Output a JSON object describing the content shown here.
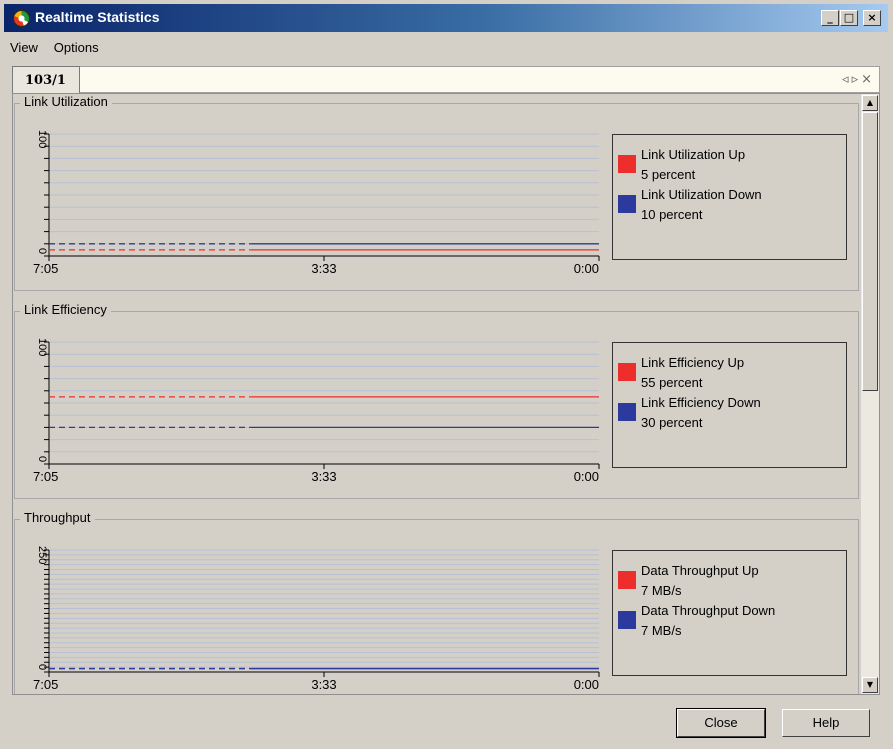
{
  "window": {
    "title": "Realtime Statistics",
    "minimize_glyph": "_",
    "maximize_glyph": "□",
    "close_glyph": "×"
  },
  "menu": [
    "View",
    "Options"
  ],
  "tab": {
    "label": "103/1",
    "controls": "◃▹×"
  },
  "panels": [
    {
      "title": "Link Utilization",
      "y_max_label": "100",
      "y_min_label": "0",
      "x_labels": [
        "7:05",
        "3:33",
        "0:00"
      ],
      "legend": [
        {
          "name": "Link Utilization Up",
          "value": "5 percent",
          "color": "#ee2d2d"
        },
        {
          "name": "Link Utilization Down",
          "value": "10 percent",
          "color": "#2b3a9c"
        }
      ]
    },
    {
      "title": "Link Efficiency",
      "y_max_label": "100",
      "y_min_label": "0",
      "x_labels": [
        "7:05",
        "3:33",
        "0:00"
      ],
      "legend": [
        {
          "name": "Link Efficiency Up",
          "value": "55 percent",
          "color": "#ee2d2d"
        },
        {
          "name": "Link Efficiency Down",
          "value": "30 percent",
          "color": "#2b3a9c"
        }
      ]
    },
    {
      "title": "Throughput",
      "y_max_label": "250",
      "y_min_label": "0",
      "x_labels": [
        "7:05",
        "3:33",
        "0:00"
      ],
      "legend": [
        {
          "name": "Data Throughput Up",
          "value": "7 MB/s",
          "color": "#ee2d2d"
        },
        {
          "name": "Data Throughput Down",
          "value": "7 MB/s",
          "color": "#2b3a9c"
        }
      ]
    }
  ],
  "buttons": {
    "close": "Close",
    "help": "Help"
  },
  "chart_data": [
    {
      "type": "line",
      "title": "Link Utilization",
      "ylim": [
        0,
        100
      ],
      "ytick_step": 10,
      "x": [
        "7:05",
        "3:33",
        "0:00"
      ],
      "series": [
        {
          "name": "Link Utilization Up",
          "values": [
            5,
            5,
            5
          ]
        },
        {
          "name": "Link Utilization Down",
          "values": [
            10,
            10,
            10
          ]
        }
      ]
    },
    {
      "type": "line",
      "title": "Link Efficiency",
      "ylim": [
        0,
        100
      ],
      "ytick_step": 10,
      "x": [
        "7:05",
        "3:33",
        "0:00"
      ],
      "series": [
        {
          "name": "Link Efficiency Up",
          "values": [
            55,
            55,
            55
          ]
        },
        {
          "name": "Link Efficiency Down",
          "values": [
            30,
            30,
            30
          ]
        }
      ]
    },
    {
      "type": "line",
      "title": "Throughput",
      "ylim": [
        0,
        250
      ],
      "ytick_step": 10,
      "x": [
        "7:05",
        "3:33",
        "0:00"
      ],
      "series": [
        {
          "name": "Data Throughput Up",
          "values": [
            7,
            7,
            7
          ]
        },
        {
          "name": "Data Throughput Down",
          "values": [
            7,
            7,
            7
          ]
        }
      ]
    }
  ]
}
